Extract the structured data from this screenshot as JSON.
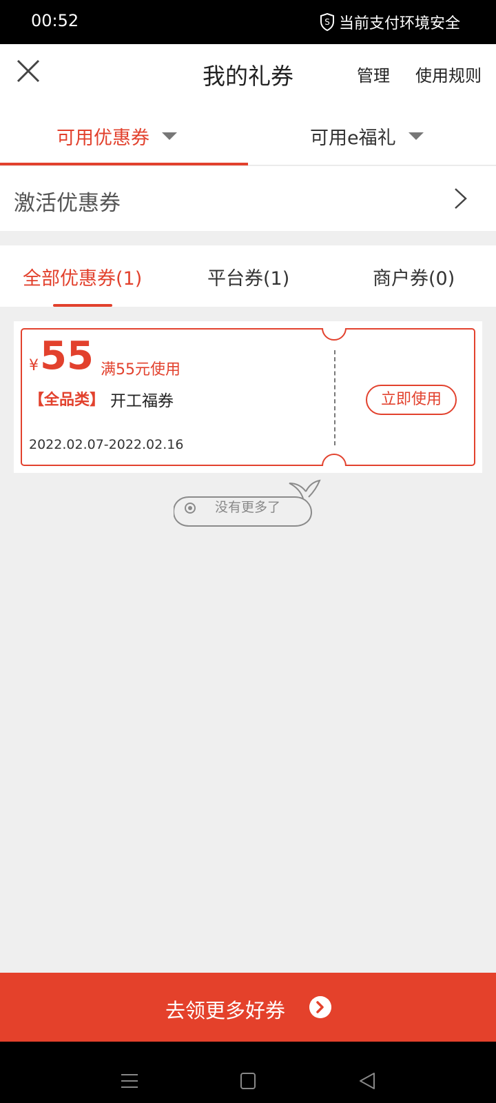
{
  "status": {
    "time": "00:52",
    "security_text": "当前支付环境安全"
  },
  "header": {
    "title": "我的礼券",
    "manage": "管理",
    "rules": "使用规则"
  },
  "top_tabs": [
    {
      "label": "可用优惠券",
      "active": true
    },
    {
      "label": "可用e福礼",
      "active": false
    }
  ],
  "activate": {
    "label": "激活优惠券"
  },
  "sub_tabs": [
    {
      "label": "全部优惠券(1)",
      "active": true
    },
    {
      "label": "平台券(1)",
      "active": false
    },
    {
      "label": "商户券(0)",
      "active": false
    }
  ],
  "coupon": {
    "currency": "¥",
    "amount": "55",
    "condition": "满55元使用",
    "category": "【全品类】",
    "name": "开工福券",
    "valid_range": "2022.02.07-2022.02.16",
    "use_label": "立即使用"
  },
  "no_more": "没有更多了",
  "cta": {
    "label": "去领更多好券"
  },
  "colors": {
    "accent": "#e2412d",
    "cta_bg": "#e4412b",
    "page_bg": "#efefef"
  }
}
